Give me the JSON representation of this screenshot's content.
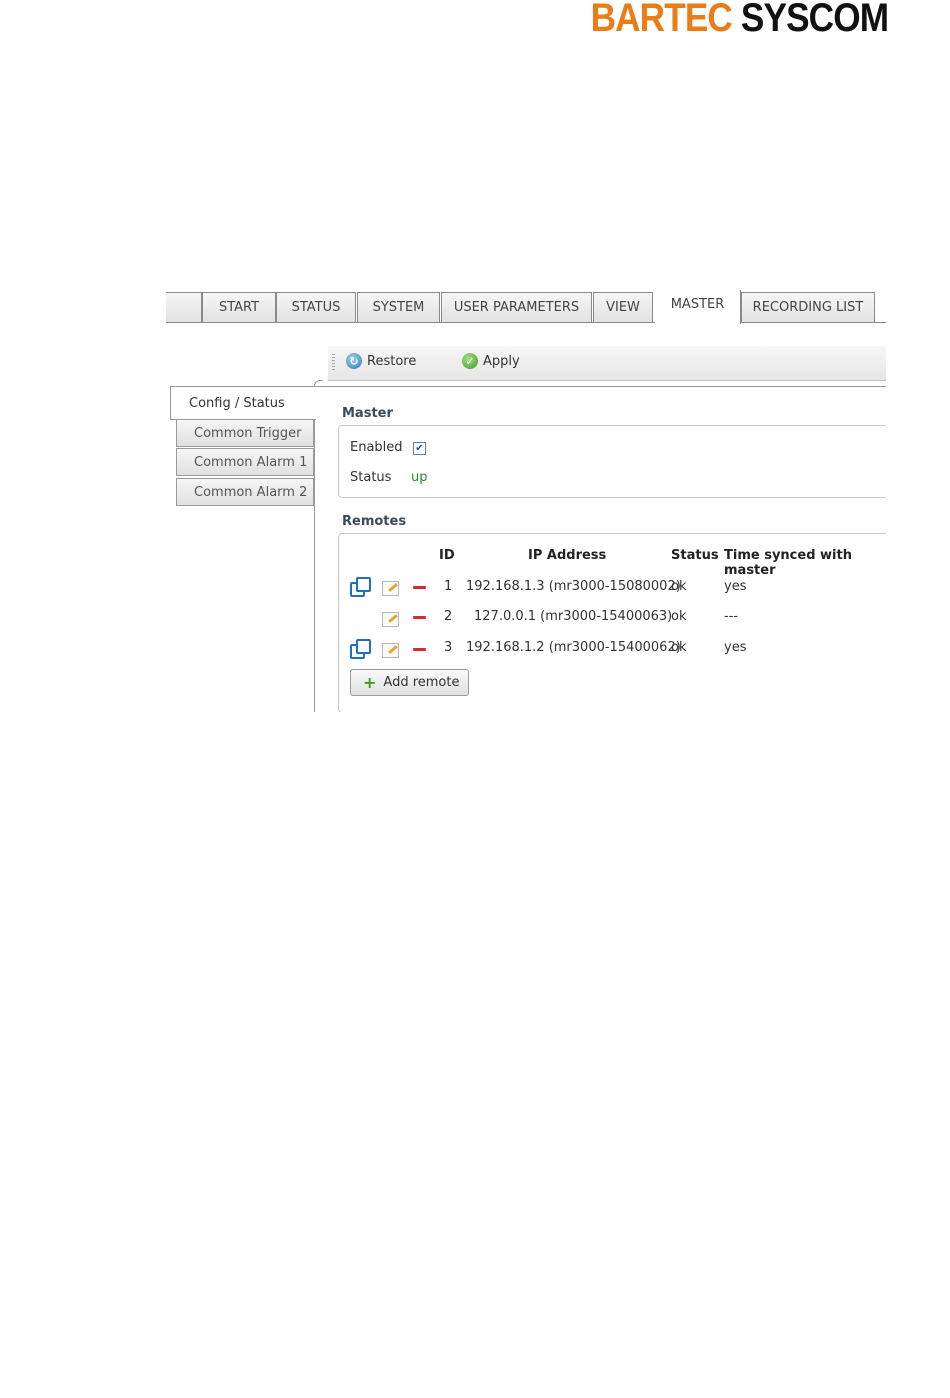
{
  "brand": {
    "part1": "BARTEC",
    "part2": "SYSCOM"
  },
  "tabs": [
    {
      "label": ""
    },
    {
      "label": "START"
    },
    {
      "label": "STATUS"
    },
    {
      "label": "SYSTEM"
    },
    {
      "label": "USER PARAMETERS"
    },
    {
      "label": "VIEW"
    },
    {
      "label": "MASTER"
    },
    {
      "label": "RECORDING LIST"
    }
  ],
  "toolbar": {
    "restore_label": "Restore",
    "apply_label": "Apply"
  },
  "sidebar": {
    "items": [
      {
        "label": "Config / Status"
      },
      {
        "label": "Common Trigger"
      },
      {
        "label": "Common Alarm 1"
      },
      {
        "label": "Common Alarm 2"
      }
    ]
  },
  "master": {
    "title": "Master",
    "enabled_label": "Enabled",
    "enabled": true,
    "status_label": "Status",
    "status_value": "up"
  },
  "remotes": {
    "title": "Remotes",
    "columns": {
      "id": "ID",
      "ip": "IP Address",
      "status": "Status",
      "synced": "Time synced with master"
    },
    "rows": [
      {
        "id": "1",
        "ip": "192.168.1.3 (mr3000-15080002)",
        "status": "ok",
        "synced": "yes",
        "link_icon": true
      },
      {
        "id": "2",
        "ip": "127.0.0.1 (mr3000-15400063)",
        "status": "ok",
        "synced": "---",
        "link_icon": false
      },
      {
        "id": "3",
        "ip": "192.168.1.2 (mr3000-15400062)",
        "status": "ok",
        "synced": "yes",
        "link_icon": true
      }
    ],
    "add_label": "Add remote"
  },
  "colors": {
    "accent": "#e97d16",
    "link_blue": "#1f6fc2",
    "ok_green": "#2e8b2e",
    "remove_red": "#d62b2b"
  },
  "icons": [
    "restore-icon",
    "apply-icon",
    "checkbox-icon",
    "link-icon",
    "edit-icon",
    "remove-icon",
    "plus-icon"
  ]
}
